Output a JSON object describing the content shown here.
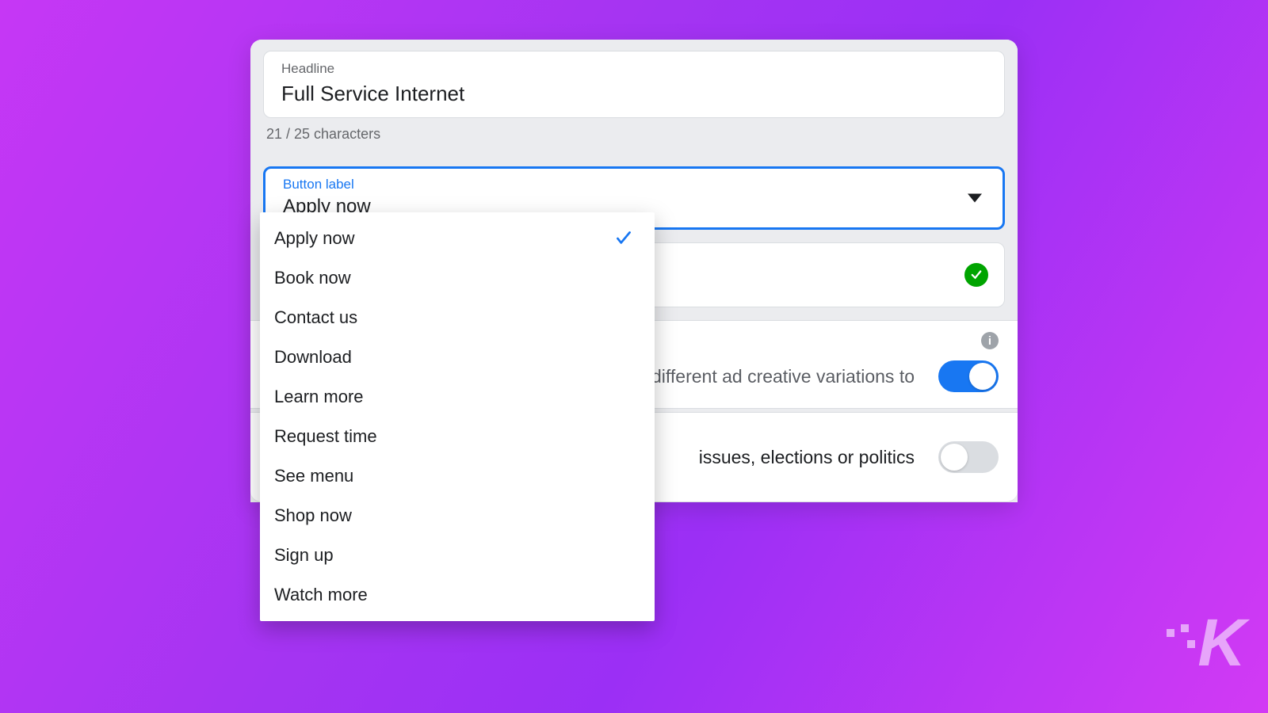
{
  "headline": {
    "label": "Headline",
    "value": "Full Service Internet",
    "char_count": "21 / 25 characters"
  },
  "button_select": {
    "label": "Button label",
    "value": "Apply now",
    "options": [
      "Apply now",
      "Book now",
      "Contact us",
      "Download",
      "Learn more",
      "Request time",
      "See menu",
      "Shop now",
      "Sign up",
      "Watch more"
    ],
    "selected_index": 0
  },
  "panel_creative": {
    "text": "different ad creative variations to",
    "toggle_on": true
  },
  "panel_politics": {
    "text": "issues, elections or politics",
    "toggle_on": false
  }
}
